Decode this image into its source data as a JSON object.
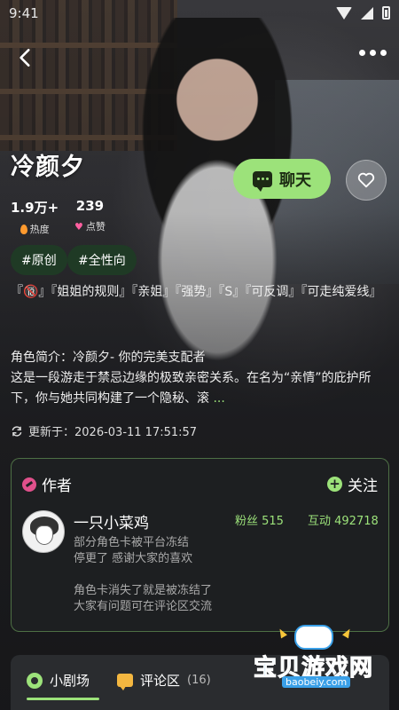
{
  "status_bar": {
    "time": "9:41"
  },
  "character": {
    "name": "冷颜夕",
    "heat_value": "1.9万+",
    "heat_label": "热度",
    "likes_value": "239",
    "likes_label": "点赞",
    "chat_button": "聊天",
    "tags": [
      "#原创",
      "#全性向"
    ],
    "keywords": "『🔞』『姐姐的规则』『亲姐』『强势』『S』『可反调』『可走纯爱线』",
    "intro_line1": "角色简介：冷颜夕- 你的完美支配者",
    "intro_line2": "这是一段游走于禁忌边缘的极致亲密关系。在名为“亲情”的庇护所下，你与她共同构建了一个隐秘、滚",
    "intro_more": "...",
    "updated": "更新于：2026-03-11 17:51:57"
  },
  "author": {
    "section_title": "作者",
    "follow_label": "关注",
    "name": "一只小菜鸡",
    "fans": "粉丝 515",
    "interactions": "互动 492718",
    "bio_line1": "部分角色卡被平台冻结",
    "bio_line2": "停更了 感谢大家的喜欢",
    "bio_line3": "角色卡消失了就是被冻结了",
    "bio_line4": "大家有问题可在评论区交流"
  },
  "tabs": {
    "theater": "小剧场",
    "comments": "评论区",
    "comments_count": "(16)"
  },
  "watermark": {
    "text": "宝贝游戏网",
    "url": "baobeiy.com"
  },
  "colors": {
    "accent": "#9ce27a",
    "tag_bg": "#1f3a25",
    "card_bg": "#1e2022"
  }
}
